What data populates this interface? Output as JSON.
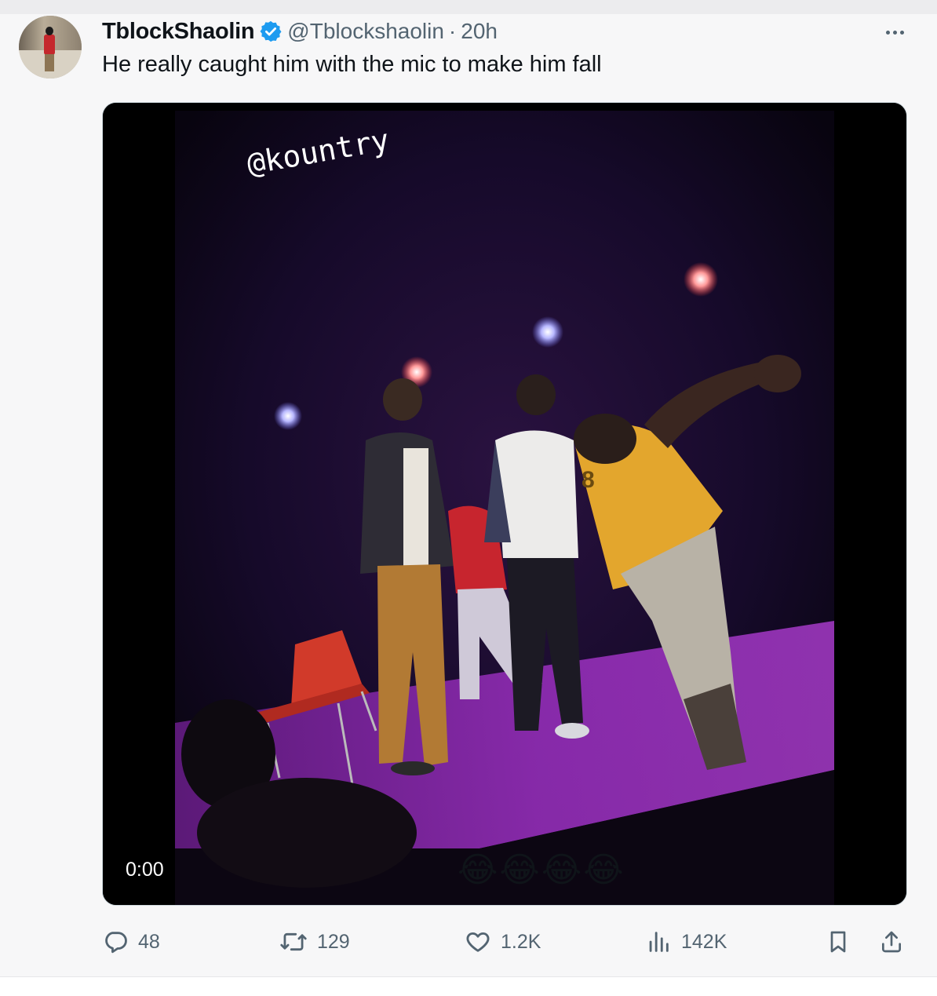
{
  "tweet": {
    "author_name": "TblockShaolin",
    "handle": "@Tblockshaolin",
    "separator": "·",
    "time_ago": "20h",
    "text": "He really caught him with the mic to make him fall",
    "verified": true,
    "accent_color": "#1d9bf0"
  },
  "media": {
    "type": "video",
    "watermark_text": "@kountry",
    "overlay_emojis": "😂😂😂😂",
    "video_time": "0:00"
  },
  "actions": {
    "replies": "48",
    "reposts": "129",
    "likes": "1.2K",
    "views": "142K",
    "icons": [
      "reply-icon",
      "repost-icon",
      "like-icon",
      "views-icon",
      "bookmark-icon",
      "share-icon"
    ]
  }
}
